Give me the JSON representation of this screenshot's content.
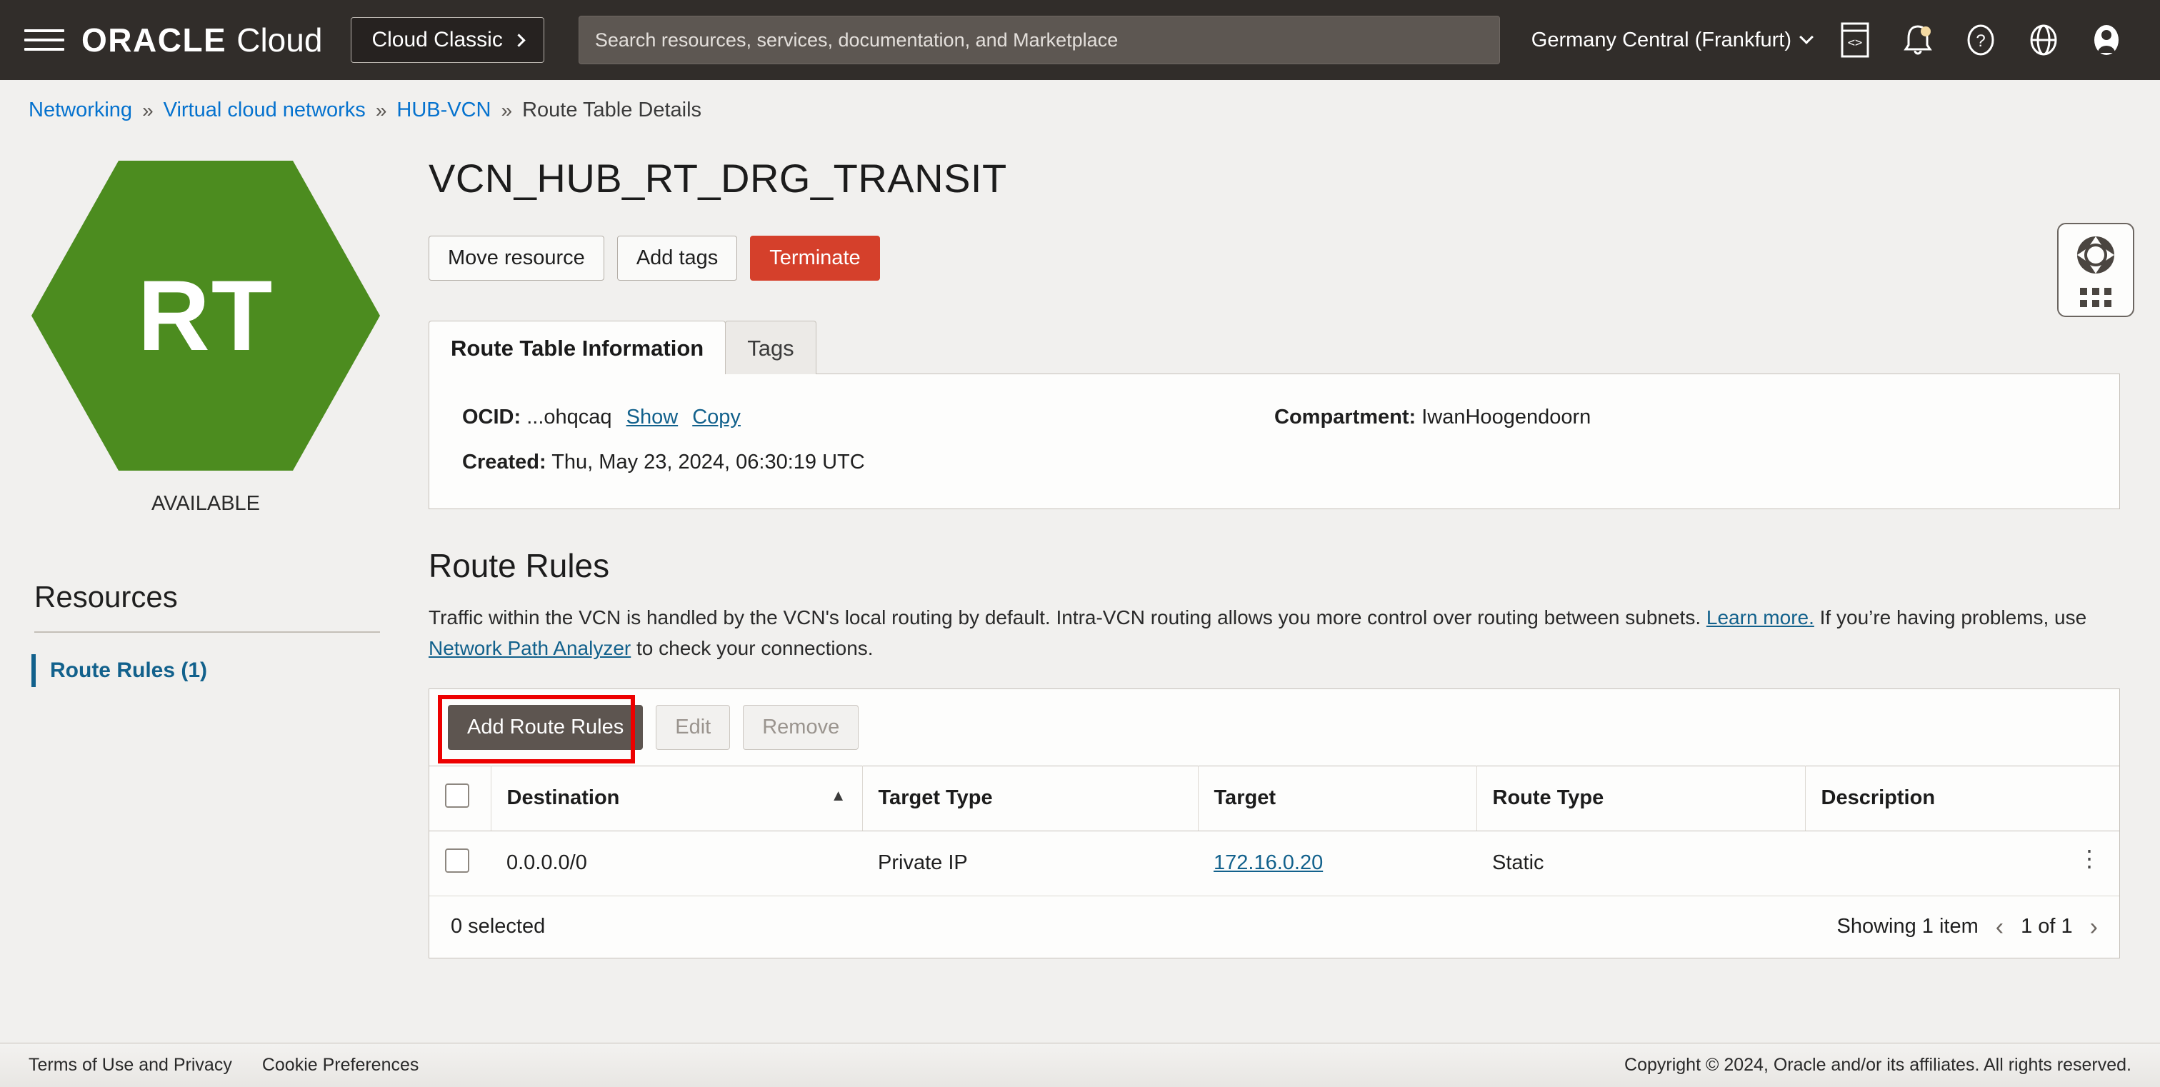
{
  "topbar": {
    "menu_icon": "hamburger-menu-icon",
    "brand_oracle": "ORACLE",
    "brand_cloud": "Cloud",
    "cloud_classic_label": "Cloud Classic",
    "search_placeholder": "Search resources, services, documentation, and Marketplace",
    "search_value": "",
    "region": "Germany Central (Frankfurt)",
    "icons": [
      "code-editor-icon",
      "notifications-bell-icon",
      "help-question-icon",
      "language-globe-icon",
      "user-avatar-icon"
    ]
  },
  "breadcrumb": {
    "items": [
      {
        "label": "Networking",
        "link": true
      },
      {
        "label": "Virtual cloud networks",
        "link": true
      },
      {
        "label": "HUB-VCN",
        "link": true
      },
      {
        "label": "Route Table Details",
        "link": false
      }
    ],
    "separator": "»"
  },
  "resource_badge": {
    "initials": "RT",
    "status": "AVAILABLE",
    "color": "#4c8c1f"
  },
  "sidebar": {
    "title": "Resources",
    "items": [
      {
        "label": "Route Rules (1)",
        "active": true
      }
    ]
  },
  "main": {
    "title": "VCN_HUB_RT_DRG_TRANSIT",
    "actions": [
      {
        "label": "Move resource",
        "style": "outline"
      },
      {
        "label": "Add tags",
        "style": "outline"
      },
      {
        "label": "Terminate",
        "style": "danger"
      }
    ],
    "tabs": [
      {
        "label": "Route Table Information",
        "active": true
      },
      {
        "label": "Tags",
        "active": false
      }
    ],
    "info": {
      "ocid_label": "OCID:",
      "ocid_value": "...ohqcaq",
      "ocid_show": "Show",
      "ocid_copy": "Copy",
      "created_label": "Created:",
      "created_value": "Thu, May 23, 2024, 06:30:19 UTC",
      "compartment_label": "Compartment:",
      "compartment_value": "IwanHoogendoorn"
    }
  },
  "route_rules": {
    "title": "Route Rules",
    "desc_part1": "Traffic within the VCN is handled by the VCN's local routing by default. Intra-VCN routing allows you more control over routing between subnets. ",
    "desc_link1": "Learn more.",
    "desc_part2": " If you’re having problems, use ",
    "desc_link2": "Network Path Analyzer",
    "desc_part3": " to check your connections.",
    "toolbar": {
      "add_label": "Add Route Rules",
      "edit_label": "Edit",
      "remove_label": "Remove",
      "highlight_color": "#ed0000"
    },
    "columns": [
      "Destination",
      "Target Type",
      "Target",
      "Route Type",
      "Description"
    ],
    "sort_column": "Destination",
    "sort_direction": "ascending",
    "rows": [
      {
        "destination": "0.0.0.0/0",
        "target_type": "Private IP",
        "target": "172.16.0.20",
        "target_is_link": true,
        "route_type": "Static",
        "description": ""
      }
    ],
    "footer": {
      "selected": "0 selected",
      "showing": "Showing 1 item",
      "page": "1 of 1"
    }
  },
  "support_widget": {
    "icon": "lifebuoy-support-icon"
  },
  "footer": {
    "terms": "Terms of Use and Privacy",
    "cookies": "Cookie Preferences",
    "copyright": "Copyright © 2024, Oracle and/or its affiliates. All rights reserved."
  }
}
